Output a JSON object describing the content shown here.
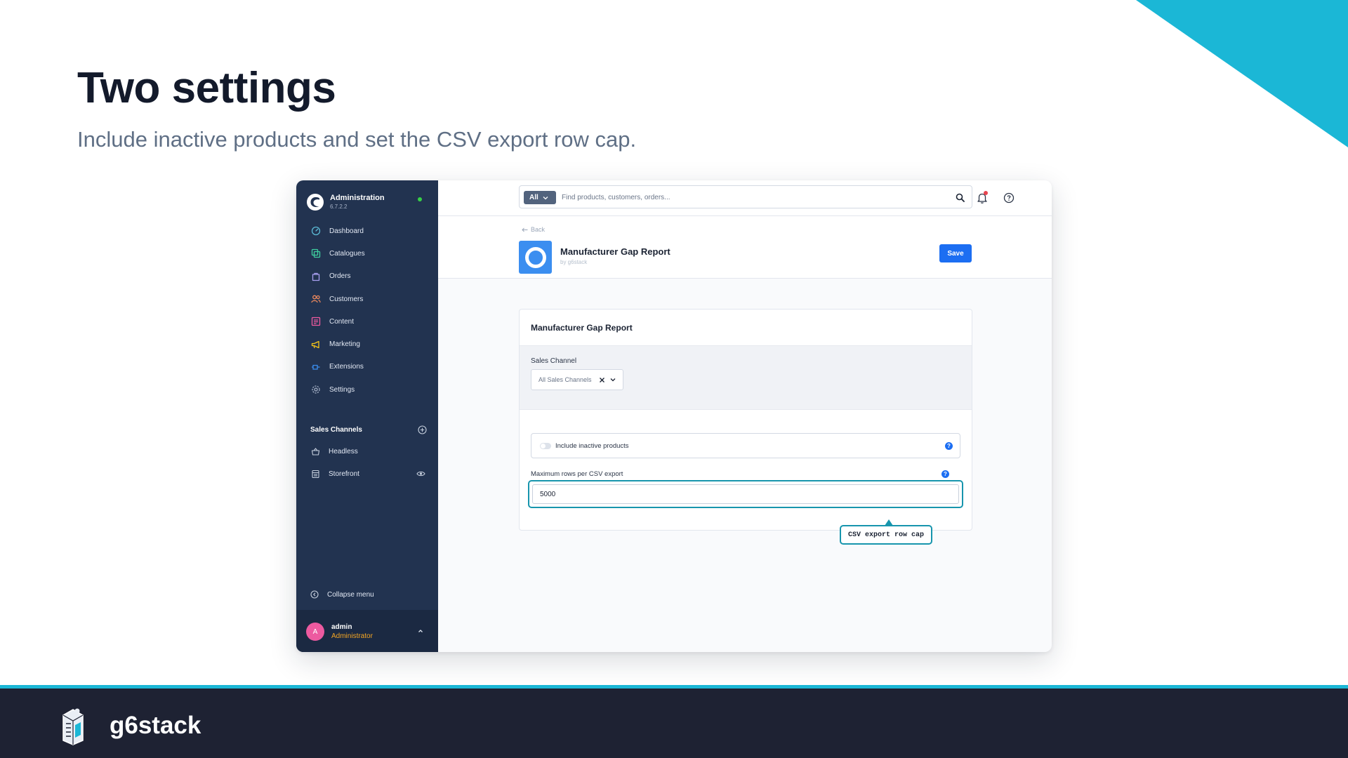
{
  "slide": {
    "title": "Two settings",
    "subtitle": "Include inactive products and set the CSV export row cap.",
    "accent_color": "#1bb7d6"
  },
  "footer": {
    "brand": "g6stack",
    "background": "#1e2233"
  },
  "sidebar": {
    "title": "Administration",
    "version": "6.7.2.2",
    "status_color": "#37d046",
    "nav_items": [
      {
        "label": "Dashboard",
        "icon": "dashboard-icon",
        "color": "#5bbad5"
      },
      {
        "label": "Catalogues",
        "icon": "catalogues-icon",
        "color": "#3fd0a0"
      },
      {
        "label": "Orders",
        "icon": "orders-icon",
        "color": "#a89ff0"
      },
      {
        "label": "Customers",
        "icon": "customers-icon",
        "color": "#f08a5d"
      },
      {
        "label": "Content",
        "icon": "content-icon",
        "color": "#ef5aa0"
      },
      {
        "label": "Marketing",
        "icon": "marketing-icon",
        "color": "#f5c518"
      },
      {
        "label": "Extensions",
        "icon": "extensions-icon",
        "color": "#3b8ef0"
      },
      {
        "label": "Settings",
        "icon": "settings-icon",
        "color": "#a5b1c6"
      }
    ],
    "sales_channels": {
      "title": "Sales Channels",
      "items": [
        {
          "label": "Headless",
          "icon": "headless-icon"
        },
        {
          "label": "Storefront",
          "icon": "storefront-icon"
        }
      ]
    },
    "collapse_label": "Collapse menu",
    "user": {
      "initial": "A",
      "name": "admin",
      "role": "Administrator"
    }
  },
  "topbar": {
    "search_type": "All",
    "search_placeholder": "Find products, customers, orders..."
  },
  "header": {
    "back_label": "Back",
    "plugin_name": "Manufacturer Gap Report",
    "plugin_author": "by g6stack",
    "save_label": "Save",
    "primary_color": "#1c6ef2"
  },
  "card": {
    "title": "Manufacturer Gap Report",
    "sales_channel_label": "Sales Channel",
    "sales_channel_value": "All Sales Channels",
    "include_inactive_label": "Include inactive products",
    "include_inactive_enabled": false,
    "max_rows_label": "Maximum rows per CSV export",
    "max_rows_value": "5000"
  },
  "callout": {
    "text": "CSV export row cap",
    "color": "#1795ad"
  }
}
